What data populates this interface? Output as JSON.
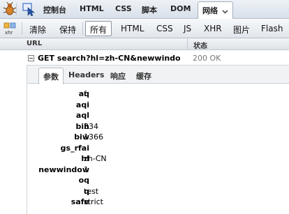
{
  "topbar": {
    "tabs": [
      {
        "label": "控制台"
      },
      {
        "label": "HTML"
      },
      {
        "label": "CSS"
      },
      {
        "label": "脚本"
      },
      {
        "label": "DOM"
      },
      {
        "label": "网络"
      }
    ],
    "active_tab": "网络",
    "dropdown_icon": "chevron-down-icon"
  },
  "toolbar": {
    "xhr_icon_label": "xhr",
    "clear_label": "清除",
    "persist_label": "保持",
    "filters": [
      "所有",
      "HTML",
      "CSS",
      "JS",
      "XHR",
      "图片",
      "Flash"
    ],
    "active_filter": "所有"
  },
  "columns": {
    "url": "URL",
    "status": "状态"
  },
  "request": {
    "url": "GET search?hl=zh-CN&newwindo",
    "status": "200 OK"
  },
  "detail_tabs": [
    "参数",
    "Headers",
    "响应",
    "缓存"
  ],
  "active_detail_tab": "参数",
  "params": [
    {
      "key": "aq",
      "value": "f"
    },
    {
      "key": "aqi",
      "value": ""
    },
    {
      "key": "aql",
      "value": ""
    },
    {
      "key": "bih",
      "value": "334"
    },
    {
      "key": "biw",
      "value": "1366"
    },
    {
      "key": "gs_rfai",
      "value": ""
    },
    {
      "key": "hl",
      "value": "zh-CN"
    },
    {
      "key": "newwindow",
      "value": "1"
    },
    {
      "key": "oq",
      "value": ""
    },
    {
      "key": "q",
      "value": "test"
    },
    {
      "key": "safe",
      "value": "strict"
    }
  ]
}
